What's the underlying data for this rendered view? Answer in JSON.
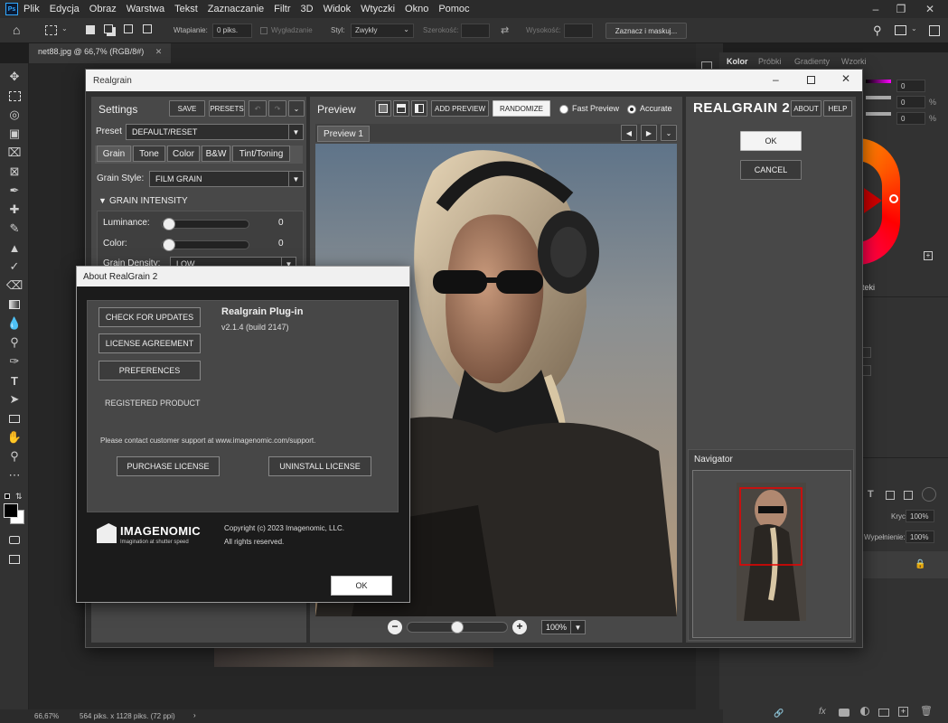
{
  "photoshop": {
    "menu": [
      "Plik",
      "Edycja",
      "Obraz",
      "Warstwa",
      "Tekst",
      "Zaznaczanie",
      "Filtr",
      "3D",
      "Widok",
      "Wtyczki",
      "Okno",
      "Pomoc"
    ],
    "options": {
      "feather_label": "Wtapianie:",
      "feather_value": "0 piks.",
      "antialias_label": "Wygładzanie",
      "style_label": "Styl:",
      "style_value": "Zwykły",
      "width_label": "Szerokość:",
      "height_label": "Wysokość:",
      "select_mask_label": "Zaznacz i maskuj..."
    },
    "doc_tab": "net88.jpg @ 66,7% (RGB/8#)",
    "status": {
      "zoom": "66,67%",
      "doc_size": "564 piks. x 1128 piks. (72 ppi)"
    },
    "panels": {
      "tabs": [
        "Kolor",
        "Próbki",
        "Gradienty",
        "Wzorki"
      ],
      "color_values": [
        "0",
        "0",
        "0"
      ],
      "pct": [
        "%",
        "%"
      ],
      "layers_partial": "teki",
      "krycie_label": "Krycie:",
      "krycie_value": "100%",
      "wypelnienie_label": "Wypełnienie:",
      "wypelnienie_value": "100%"
    }
  },
  "realgrain": {
    "window_title": "Realgrain",
    "settings": {
      "heading": "Settings",
      "save": "SAVE",
      "presets": "PRESETS",
      "preset_label": "Preset",
      "preset_value": "DEFAULT/RESET",
      "tabs": [
        "Grain",
        "Tone",
        "Color",
        "B&W",
        "Tint/Toning"
      ],
      "grain_style_label": "Grain Style:",
      "grain_style_value": "FILM GRAIN",
      "section": "GRAIN INTENSITY",
      "luminance_label": "Luminance:",
      "luminance_value": "0",
      "color_label": "Color:",
      "color_value": "0",
      "density_label": "Grain Density:",
      "density_value": "LOW"
    },
    "preview": {
      "heading": "Preview",
      "add_preview": "ADD PREVIEW",
      "randomize": "RANDOMIZE",
      "fast_preview": "Fast Preview",
      "accurate": "Accurate",
      "tab": "Preview 1",
      "zoom": "100%"
    },
    "brand": {
      "logo": "REALGRAIN 2",
      "about": "ABOUT",
      "help": "HELP",
      "ok": "OK",
      "cancel": "CANCEL",
      "navigator": "Navigator"
    }
  },
  "about": {
    "title": "About RealGrain 2",
    "check_updates": "CHECK FOR UPDATES",
    "license_agreement": "LICENSE AGREEMENT",
    "preferences": "PREFERENCES",
    "registered": "REGISTERED PRODUCT",
    "product_name": "Realgrain Plug-in",
    "version": "v2.1.4 (build 2147)",
    "support": "Please contact customer support at www.imagenomic.com/support.",
    "purchase": "PURCHASE LICENSE",
    "uninstall": "UNINSTALL LICENSE",
    "company": "IMAGENOMIC",
    "tagline": "Imagination at shutter speed",
    "copyright": "Copyright (c) 2023 Imagenomic, LLC.",
    "rights": "All rights reserved.",
    "ok": "OK"
  }
}
